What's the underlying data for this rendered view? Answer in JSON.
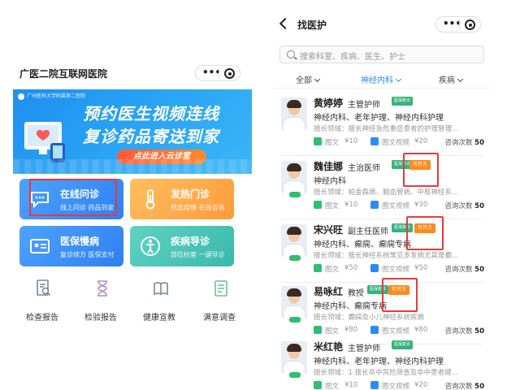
{
  "left_app": {
    "title": "广医二院互联网医院",
    "capsule_dots": "•••",
    "banner": {
      "logo_text": "广州医科大学附属第二医院",
      "line1": "预约医生视频连线",
      "line2": "复诊药品寄送到家",
      "cta": "点此进入云诊室"
    },
    "tiles": [
      {
        "title": "在线问诊",
        "sub": "线上问诊 药品到家",
        "icon": "chat-bubble-icon"
      },
      {
        "title": "发热门诊",
        "sub": "抗击疫情 在线咨询",
        "icon": "thermometer-icon"
      },
      {
        "title": "医保慢病",
        "sub": "复诊续方 医保支付",
        "icon": "id-card-icon"
      },
      {
        "title": "疾病导诊",
        "sub": "部位检索 一键导诊",
        "icon": "body-guide-icon"
      }
    ],
    "quick": [
      {
        "label": "检查报告",
        "icon": "report-search-icon"
      },
      {
        "label": "检验报告",
        "icon": "hourglass-icon"
      },
      {
        "label": "健康宣教",
        "icon": "book-icon"
      },
      {
        "label": "满意调查",
        "icon": "survey-icon"
      }
    ]
  },
  "right_app": {
    "title": "找医护",
    "capsule_dots": "•••",
    "search_placeholder": "搜索科室、疾病、医生、护士",
    "filters": [
      {
        "label": "全部",
        "active": false
      },
      {
        "label": "神经内科",
        "active": true
      },
      {
        "label": "疾病",
        "active": false
      }
    ],
    "price_label_1": "图文",
    "price_label_2": "图文视频",
    "count_label": "咨询次数",
    "doctors": [
      {
        "name": "黄婷婷",
        "title": "主管护师",
        "tag": "医保复诊",
        "tag_ok": "",
        "dept": "神经内科、老年护理、神经内科护理",
        "skill": "擅长领域：擅长神经急危重症患者的护理管理...",
        "price1": "¥10",
        "price2": "¥20",
        "count": "50"
      },
      {
        "name": "魏佳娜",
        "title": "主治医师",
        "tag": "医保复诊",
        "tag_ok": "可开方",
        "dept": "神经内科",
        "skill": "擅长领域：帕金森病、脑血管病、中枢神经系...",
        "price1": "¥10",
        "price2": "¥30",
        "count": "50"
      },
      {
        "name": "宋兴旺",
        "title": "副主任医师",
        "tag": "医保复诊",
        "tag_ok": "可开方",
        "dept": "神经内科、癫痫、癫痫专病",
        "skill": "擅长领域：擅长神经系统常见多发病尤其是癫...",
        "price1": "¥50",
        "price2": "¥50",
        "count": "50"
      },
      {
        "name": "易咏红",
        "title": "教授",
        "tag": "医保复诊",
        "tag_ok": "可开方",
        "dept": "神经内科、癫痫专病",
        "skill": "擅长领域：癫痫及小儿神经系统疾病",
        "price1": "¥80",
        "price2": "¥80",
        "count": "50"
      },
      {
        "name": "米红艳",
        "title": "主管护师",
        "tag": "医保复诊",
        "tag_ok": "",
        "dept": "神经内科、老年护理、神经内科护理",
        "skill": "擅长领域：1.擅长卒中风险筛查及卒中患者健...",
        "price1": "¥10",
        "price2": "¥20",
        "count": "50"
      }
    ]
  },
  "colors": {
    "accent_blue": "#2a8bf2",
    "highlight_red": "#e83a3a",
    "ok_orange": "#ff8a1e",
    "tag_green": "#35b37e"
  }
}
